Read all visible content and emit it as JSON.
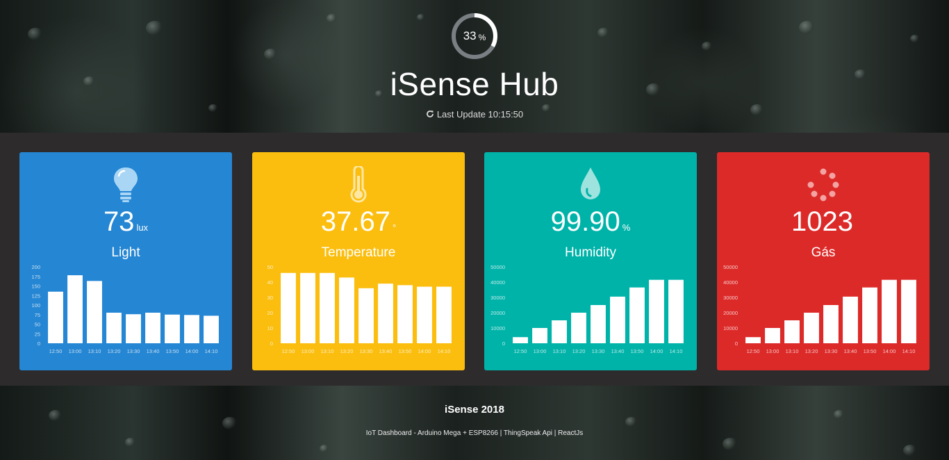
{
  "header": {
    "progress_value": "33",
    "progress_unit": "%",
    "progress_fraction": 0.33,
    "title": "iSense Hub",
    "last_update": "Last Update 10:15:50"
  },
  "cards": [
    {
      "value": "73",
      "unit": "lux",
      "label": "Light",
      "color": "#2586d3",
      "icon": "lightbulb-icon"
    },
    {
      "value": "37.67",
      "unit": "°",
      "label": "Temperature",
      "color": "#fbbe0f",
      "icon": "thermometer-icon"
    },
    {
      "value": "99.90",
      "unit": "%",
      "label": "Humidity",
      "color": "#00b3a9",
      "icon": "water-drop-icon"
    },
    {
      "value": "1023",
      "unit": "",
      "label": "Gás",
      "color": "#dc2a29",
      "icon": "spinner-icon"
    }
  ],
  "footer": {
    "title": "iSense 2018",
    "subtitle": "IoT Dashboard - Arduino Mega + ESP8266 | ThingSpeak Api | ReactJs"
  },
  "chart_data": [
    {
      "type": "bar",
      "categories": [
        "12:50",
        "13:00",
        "13:10",
        "13:20",
        "13:30",
        "13:40",
        "13:50",
        "14:00",
        "14:10"
      ],
      "values": [
        135,
        178,
        163,
        80,
        76,
        80,
        75,
        74,
        72
      ],
      "ylim": [
        0,
        200
      ],
      "yticks": [
        "0",
        "25",
        "50",
        "75",
        "100",
        "125",
        "150",
        "175",
        "200"
      ],
      "grid": false
    },
    {
      "type": "bar",
      "categories": [
        "12:50",
        "13:00",
        "13:10",
        "13:20",
        "13:30",
        "13:40",
        "13:50",
        "14:00",
        "14:10"
      ],
      "values": [
        46,
        46,
        46,
        43,
        36,
        39,
        38,
        37,
        37
      ],
      "ylim": [
        0,
        50
      ],
      "yticks": [
        "0",
        "10",
        "20",
        "30",
        "40",
        "50"
      ],
      "grid": false
    },
    {
      "type": "bar",
      "categories": [
        "12:50",
        "13:00",
        "13:10",
        "13:20",
        "13:30",
        "13:40",
        "13:50",
        "14:00",
        "14:10"
      ],
      "values": [
        4000,
        10000,
        15000,
        20000,
        25000,
        30500,
        36500,
        41500,
        41500
      ],
      "ylim": [
        0,
        50000
      ],
      "yticks": [
        "0",
        "10000",
        "20000",
        "30000",
        "40000",
        "50000"
      ],
      "grid": false
    },
    {
      "type": "bar",
      "categories": [
        "12:50",
        "13:00",
        "13:10",
        "13:20",
        "13:30",
        "13:40",
        "13:50",
        "14:00",
        "14:10"
      ],
      "values": [
        4000,
        10000,
        15000,
        20000,
        25000,
        30500,
        36500,
        41500,
        41500
      ],
      "ylim": [
        0,
        50000
      ],
      "yticks": [
        "0",
        "10000",
        "20000",
        "30000",
        "40000",
        "50000"
      ],
      "grid": false
    }
  ]
}
